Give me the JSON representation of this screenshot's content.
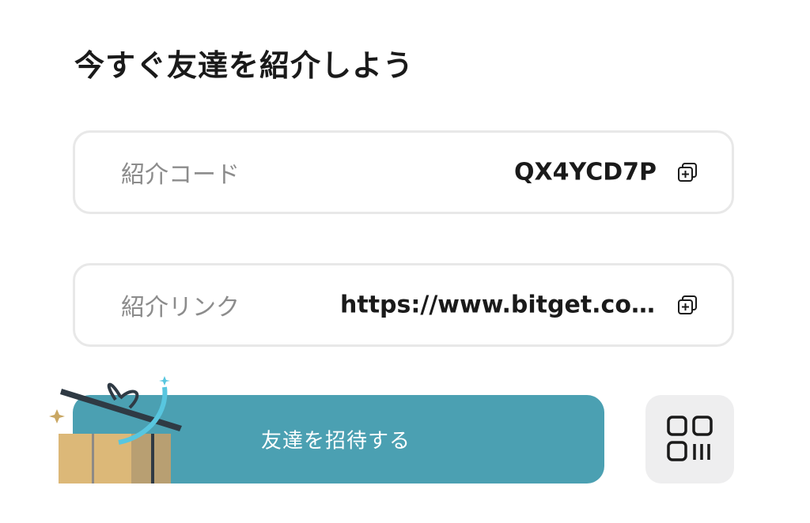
{
  "page": {
    "title": "今すぐ友達を紹介しよう"
  },
  "referral_code": {
    "label": "紹介コード",
    "value": "QX4YCD7P",
    "copy_icon": "copy-icon"
  },
  "referral_link": {
    "label": "紹介リンク",
    "value": "https://www.bitget.com...",
    "copy_icon": "copy-icon"
  },
  "invite": {
    "label": "友達を招待する",
    "illustration": "gift-box-icon",
    "color": "#4ba0b2"
  },
  "qr": {
    "icon": "qr-code-icon"
  }
}
